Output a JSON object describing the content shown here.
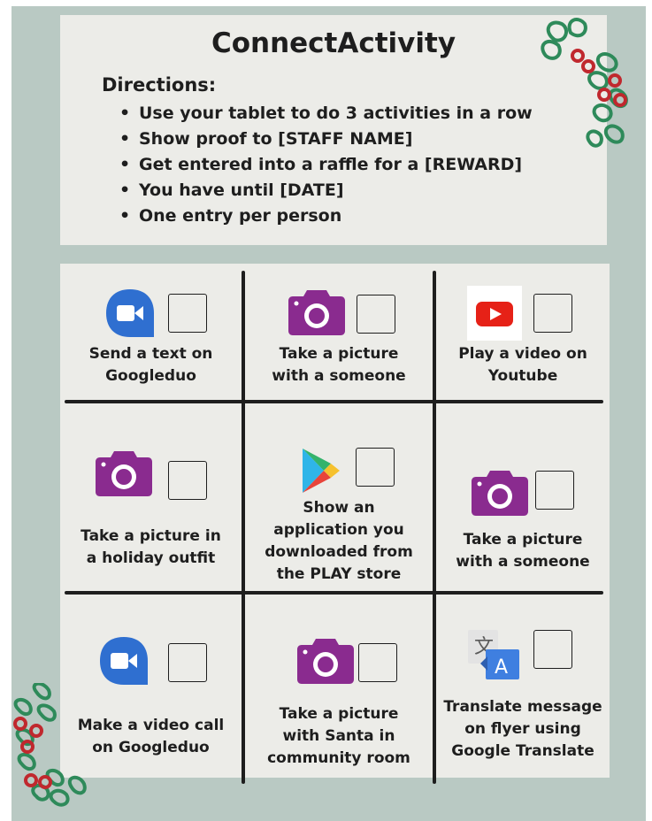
{
  "header": {
    "title": "ConnectActivity",
    "directions_label": "Directions:",
    "directions": [
      "Use your tablet to do 3 activities in a row",
      "Show proof to [STAFF NAME]",
      "Get entered into a raffle for a [REWARD]",
      "You have until [DATE]",
      "One entry per person"
    ]
  },
  "grid": {
    "cells": [
      {
        "icon": "google-duo-icon",
        "lines": [
          "Send a text on",
          "Googleduo"
        ],
        "checked": false
      },
      {
        "icon": "camera-icon",
        "lines": [
          "Take  a  picture",
          "with a someone"
        ],
        "checked": false
      },
      {
        "icon": "youtube-icon",
        "lines": [
          "Play a video on",
          "Youtube"
        ],
        "checked": false
      },
      {
        "icon": "camera-icon",
        "lines": [
          "Take a picture in",
          "a holiday outfit"
        ],
        "checked": false
      },
      {
        "icon": "google-play-icon",
        "lines": [
          "Show an",
          "application you",
          "downloaded from",
          "the PLAY store"
        ],
        "checked": false
      },
      {
        "icon": "camera-icon",
        "lines": [
          "Take  a  picture",
          "with a someone"
        ],
        "checked": false
      },
      {
        "icon": "google-duo-icon",
        "lines": [
          "Make a video call",
          "on Googleduo"
        ],
        "checked": false
      },
      {
        "icon": "camera-icon",
        "lines": [
          "Take a picture",
          "with Santa in",
          "community room"
        ],
        "checked": false
      },
      {
        "icon": "google-translate-icon",
        "lines": [
          "Translate message",
          "on flyer using",
          "Google Translate"
        ],
        "checked": false
      }
    ]
  },
  "colors": {
    "background": "#b9c9c3",
    "card": "#ecece8",
    "camera": "#8a2b8f",
    "duo": "#2f6fd0",
    "youtube": "#e62117",
    "holly_leaf": "#2e8a5a",
    "holly_berry": "#c0282e"
  }
}
